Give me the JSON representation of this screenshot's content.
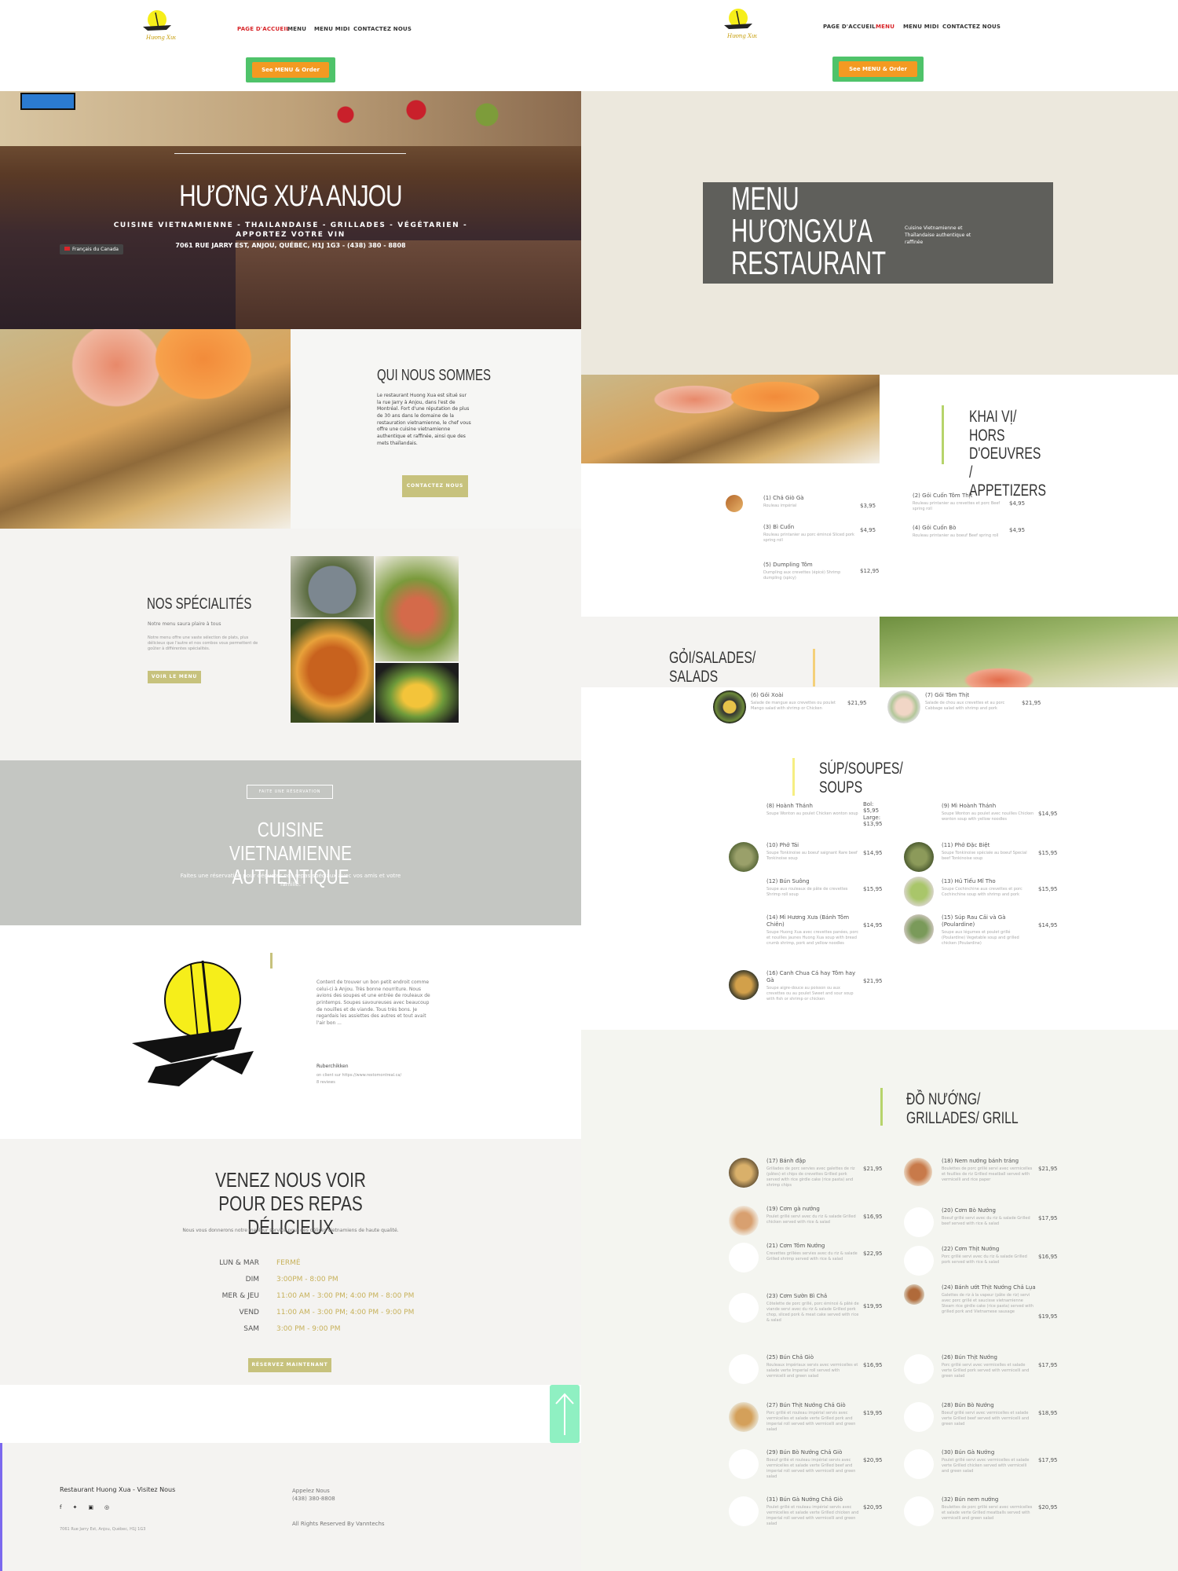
{
  "left": {
    "nav": [
      "PAGE D'ACCUEIL",
      "MENU",
      "MENU MIDI",
      "CONTACTEZ NOUS"
    ],
    "order_btn": "See MENU & Order",
    "hero": {
      "title": "HƯƠNG XƯA ANJOU",
      "subtitle": "CUISINE VIETNAMIENNE - THAILANDAISE - GRILLADES - VÉGÉTARIEN - APPORTEZ VOTRE VIN",
      "address": "7061 RUE JARRY EST, ANJOU, QUÉBEC, H1J 1G3 - (438) 380 - 8808",
      "lang": "Français du Canada"
    },
    "about": {
      "title": "QUI NOUS SOMMES",
      "text": "Le restaurant Huong Xua est situé sur la rue Jarry à Anjou, dans l'est de Montréal. Fort d'une réputation de plus de 30 ans dans le domaine de la restauration vietnamienne, le chef vous offre une cuisine vietnamienne authentique et raffinée, ainsi que des mets thaïlandais.",
      "button": "CONTACTEZ NOUS"
    },
    "specialites": {
      "title": "NOS SPÉCIALITÉS",
      "tagline": "Notre menu saura plaire à tous",
      "text": "Notre menu offre une vaste sélection de plats, plus délicieux que l'autre et nos combos vous permettent de goûter à différentes spécialités.",
      "button": "VOIR LE MENU"
    },
    "reservation": {
      "badge": "FAITE UNE RÉSERVATION",
      "title": "CUISINE VIETNAMIENNE AUTHENTIQUE",
      "text": "Faites une réservation pour déguster nos repas spéciaux avec vos amis et votre famille."
    },
    "review": {
      "text": "Content de trouver un bon petit endroit comme celui-ci à Anjou. Très bonne nourriture. Nous avions des soupes et une entrée de rouleaux de printemps. Soupes savoureuses avec beaucoup de nouilles et de viande. Tous très bons. Je regardais les assiettes des autres et tout avait l'air bon ...",
      "author": "Ruberchikken",
      "source": "on client sur https://www.restomontreal.ca/",
      "count": "8 reviews"
    },
    "hours": {
      "title": "VENEZ NOUS VOIR POUR DES REPAS DÉLICIEUX",
      "text": "Nous vous donnerons notre meilleur service pour des délices vietnamiens de haute qualité.",
      "rows": [
        [
          "LUN & MAR",
          "FERMÉ"
        ],
        [
          "DIM",
          "3:00PM - 8:00 PM"
        ],
        [
          "MER & JEU",
          "11:00 AM - 3:00 PM; 4:00 PM - 8:00 PM"
        ],
        [
          "VEND",
          "11:00 AM - 3:00 PM; 4:00 PM - 9:00 PM"
        ],
        [
          "SAM",
          "3:00 PM - 9:00 PM"
        ]
      ],
      "button": "RÉSERVEZ MAINTENANT"
    },
    "footer": {
      "name": "Restaurant Huong Xua - Visitez Nous",
      "address": "7061 Rue Jarry Est, Anjou, Québec, H1J 1G3",
      "call": "Appelez Nous",
      "phone": "(438) 380-8808",
      "rights": "All Rights Reserved By Vanntechs"
    }
  },
  "right": {
    "nav": [
      "PAGE D'ACCUEIL",
      "MENU",
      "MENU MIDI",
      "CONTACTEZ NOUS"
    ],
    "order_btn": "See MENU & Order",
    "hero": {
      "title1": "MENU",
      "title2": "HƯƠNGXƯA",
      "title3": "RESTAURANT",
      "text": "Cuisine Vietnamienne et Thaïlandaise authentique et raffinée"
    },
    "appetizers": {
      "title": "KHAI VỊ/ HORS D'OEUVRES / APPETIZERS",
      "items": [
        {
          "name": "(1) Chả Giò Gà",
          "desc": "Rouleau impérial",
          "price": "$3,95"
        },
        {
          "name": "(2) Gỏi Cuốn Tôm Thịt",
          "desc": "Rouleau printanier au crevettes et porc Beef spring roll",
          "price": "$4,95"
        },
        {
          "name": "(3) Bì Cuốn",
          "desc": "Rouleau printanier au porc émincé Sliced pork spring roll",
          "price": "$4,95"
        },
        {
          "name": "(4) Gỏi Cuốn Bò",
          "desc": "Rouleau printanier au boeuf Beef spring roll",
          "price": "$4,95"
        },
        {
          "name": "(5) Dumpling Tôm",
          "desc": "Dumpling aux crevettes (épicé) Shrimp dumpling (spicy)",
          "price": "$12,95"
        }
      ]
    },
    "salads": {
      "title": "GỎI/SALADES/ SALADS",
      "items": [
        {
          "name": "(6) Gỏi Xoài",
          "desc": "Salade de mangue aux crevettes ou poulet Mango salad with shrimp or Chicken",
          "price": "$21,95"
        },
        {
          "name": "(7) Gỏi Tôm Thịt",
          "desc": "Salade de chou aux crevettes et au porc Cabbage salad with shrimp and pork",
          "price": "$21,95"
        }
      ]
    },
    "soups": {
      "title": "SÚP/SOUPES/ SOUPS",
      "items": [
        {
          "name": "(8) Hoành Thánh",
          "desc": "Soupe Wonton au poulet Chicken wonton soup",
          "price": "Bol: $5,95 Large: $13,95"
        },
        {
          "name": "(9) Mì Hoành Thánh",
          "desc": "Soupe Wonton au poulet avec nouilles Chicken wonton soup with yellow noodles",
          "price": "$14,95"
        },
        {
          "name": "(10) Phở Tái",
          "desc": "Soupe Tonkinoise au boeuf saignant Rare beef Tonkinoise soup",
          "price": "$14,95"
        },
        {
          "name": "(11) Phở Đặc Biệt",
          "desc": "Soupe Tonkinoise spéciale au boeuf Special beef Tonkinoise soup",
          "price": "$15,95"
        },
        {
          "name": "(12) Bún Suông",
          "desc": "Soupe aux rouleaux de pâte de crevettes Shrimp roll soup",
          "price": "$15,95"
        },
        {
          "name": "(13) Hủ Tiếu Mĩ Tho",
          "desc": "Soupe Cochinchine aux crevettes et porc Cochinchine soup with shrimp and pork",
          "price": "$15,95"
        },
        {
          "name": "(14) Mì Hương Xưa (Bánh Tôm Chiên)",
          "desc": "Soupe Huong Xua avec crevettes panées, porc et nouilles jaunes Huong Xua soup with bread crumb shrimp, pork and yellow noodles",
          "price": "$14,95"
        },
        {
          "name": "(15) Súp Rau Cải và Gà (Poulardine)",
          "desc": "Soupe aux légumes et poulet grillé (Poulardine) Vegetable soup and grilled chicken (Poulardine)",
          "price": "$14,95"
        },
        {
          "name": "(16) Canh Chua Cá hay Tôm hay Gà",
          "desc": "Soupe aigre-douce au poisson ou aux crevettes ou au poulet Sweet and sour soup with fish or shrimp or chicken",
          "price": "$21,95"
        }
      ]
    },
    "grill": {
      "title": "ĐỒ NƯỚNG/ GRILLADES/ GRILL",
      "items": [
        {
          "name": "(17) Bánh đập",
          "desc": "Grillades de porc servies avec galettes de riz (pâtes) et chips de crevettes Grilled pork served with rice girdle cake (rice pasta) and shrimp chips",
          "price": "$21,95"
        },
        {
          "name": "(18) Nem nướng bánh tráng",
          "desc": "Boulettes de porc grillé servi avec vermicelles et feuilles de riz Grilled meatball served with vermicelli and rice paper",
          "price": "$21,95"
        },
        {
          "name": "(19) Cơm gà nướng",
          "desc": "Poulet grillé servi avec du riz & salade Grilled chicken served with rice & salad",
          "price": "$16,95"
        },
        {
          "name": "(20) Cơm Bò Nướng",
          "desc": "Boeuf grillé servi avec du riz & salade Grilled beef served with rice & salad",
          "price": "$17,95"
        },
        {
          "name": "(21) Cơm Tôm Nướng",
          "desc": "Crevettes grillées servies avec du riz & salade Grilled shrimp served with rice & salad",
          "price": "$22,95"
        },
        {
          "name": "(22) Cơm Thịt Nướng",
          "desc": "Porc grillé servi avec du riz & salade Grilled pork served with rice & salad",
          "price": "$16,95"
        },
        {
          "name": "(23) Cơm Sườn Bì Chả",
          "desc": "Côtelette de porc grillé, porc émincé & pâté de viande servi avec du riz & salade Grilled pork chop, sliced pork & meat cake served with rice & salad",
          "price": "$19,95"
        },
        {
          "name": "(24) Bánh ướt Thịt Nướng Chả Lụa",
          "desc": "Galettes de riz à la vapeur (pâte de riz) servi avec porc grillé et saucisse vietnamienne Steam rice girdle cake (rice pasta) served with grilled pork and Vietnamese sausage",
          "price": "$19,95"
        },
        {
          "name": "(25) Bún Chả Giò",
          "desc": "Rouleaux impériaux servis avec vermicelles et salade verte Imperial roll served with vermicelli and green salad",
          "price": "$16,95"
        },
        {
          "name": "(26) Bún Thịt Nướng",
          "desc": "Porc grillé servi avec vermicelles et salade verte Grilled pork served with vermicelli and green salad",
          "price": "$17,95"
        },
        {
          "name": "(27) Bún Thịt Nướng Chả Giò",
          "desc": "Porc grillé et rouleau impérial servis avec vermicelles et salade verte Grilled pork and imperial roll served with vermicelli and green salad",
          "price": "$19,95"
        },
        {
          "name": "(28) Bún Bò Nướng",
          "desc": "Boeuf grillé servi avec vermicelles et salade verte Grilled beef served with vermicelli and green salad",
          "price": "$18,95"
        },
        {
          "name": "(29) Bún Bò Nướng Chả Giò",
          "desc": "Boeuf grillé et rouleau impérial servis avec vermicelles et salade verte Grilled beef and imperial roll served with vermicelli and green salad",
          "price": "$20,95"
        },
        {
          "name": "(30) Bún Gà Nướng",
          "desc": "Poulet grillé servi avec vermicelles et salade verte Grilled chicken served with vermicelli and green salad",
          "price": "$17,95"
        },
        {
          "name": "(31) Bún Gà Nướng Chả Giò",
          "desc": "Poulet grillé et rouleau impérial servis avec vermicelles et salade verte Grilled chicken and imperial roll served with vermicelli and green salad",
          "price": "$20,95"
        },
        {
          "name": "(32) Bún nem nướng",
          "desc": "Boulettes de porc grillé servi avec vermicelles et salade verte Grilled meatballs served with vermicelli and green salad",
          "price": "$20,95"
        }
      ]
    }
  },
  "colors": {
    "olive": "#c7c27d",
    "accent_red": "#d8262a",
    "orange": "#f39a22",
    "green": "#4fc36a",
    "gray_band": "#c4c6c2",
    "hero_box": "#5f5f5b",
    "cream": "#ece8dd",
    "scroll_top": "#8ff0c2"
  }
}
